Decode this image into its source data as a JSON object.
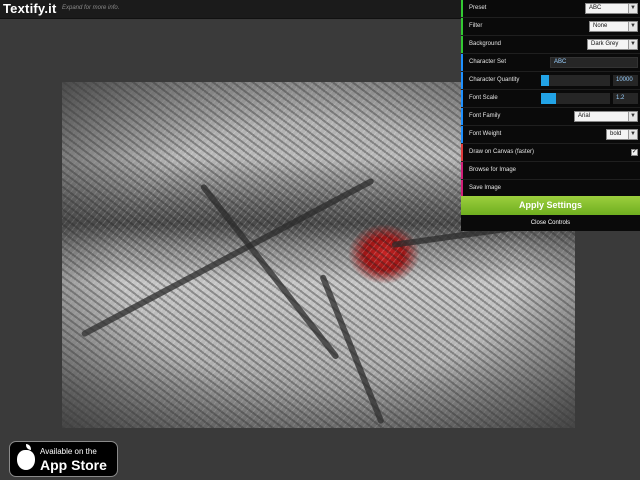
{
  "header": {
    "logo": "Textify.it",
    "tagline": "Expand for more info."
  },
  "controls": {
    "preset": {
      "label": "Preset",
      "value": "ABC"
    },
    "filter": {
      "label": "Filter",
      "value": "None"
    },
    "background": {
      "label": "Background",
      "value": "Dark Grey"
    },
    "character_set": {
      "label": "Character Set",
      "value": "ABC"
    },
    "character_quantity": {
      "label": "Character Quantity",
      "value": "10000",
      "level": 0.12
    },
    "font_scale": {
      "label": "Font Scale",
      "value": "1.2",
      "level": 0.22
    },
    "font_family": {
      "label": "Font Family",
      "value": "Arial"
    },
    "font_weight": {
      "label": "Font Weight",
      "value": "bold"
    },
    "draw_on_canvas": {
      "label": "Draw on Canvas (faster)",
      "checked": true
    },
    "browse": {
      "label": "Browse for Image"
    },
    "save": {
      "label": "Save Image"
    },
    "apply_label": "Apply Settings",
    "close_label": "Close Controls"
  },
  "app_store": {
    "small": "Available on the",
    "big": "App Store"
  },
  "colors": {
    "accent_green": "#32c832",
    "accent_blue": "#1e90ff",
    "accent_red": "#e03c3c",
    "accent_magenta": "#d01e78",
    "apply_green": "#8cc63f",
    "slider_blue": "#22a3e6"
  }
}
